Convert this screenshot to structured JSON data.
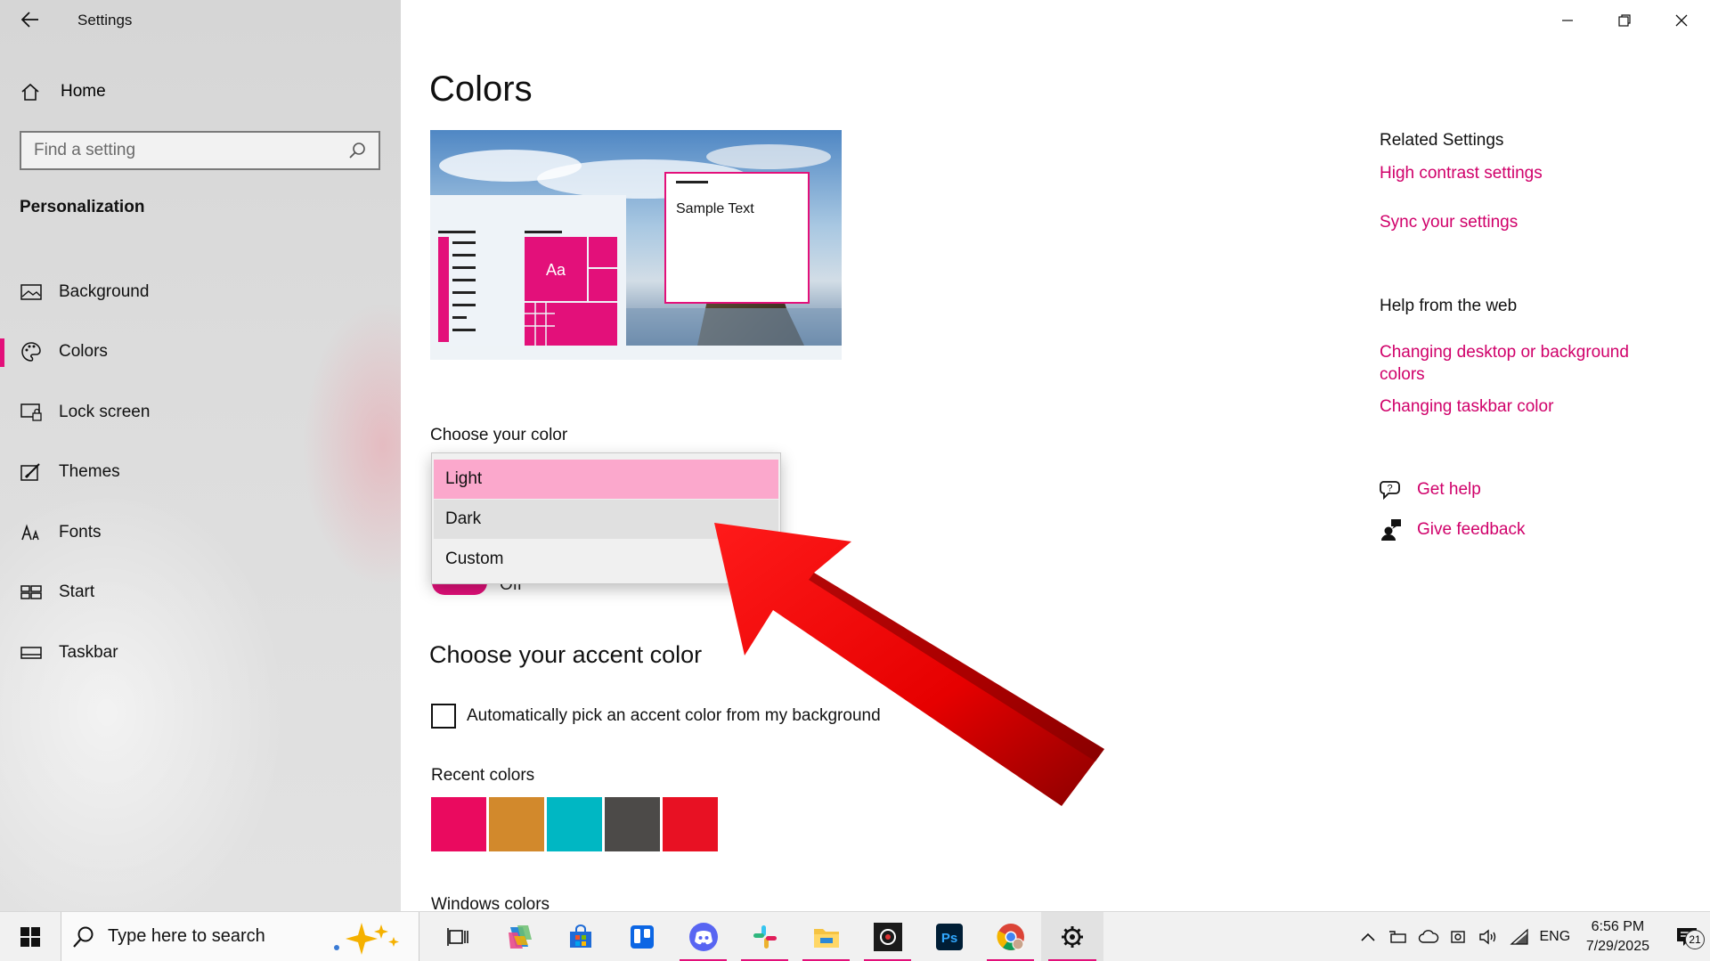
{
  "window": {
    "title": "Settings"
  },
  "sidebar": {
    "home_label": "Home",
    "search_placeholder": "Find a setting",
    "section": "Personalization",
    "items": [
      {
        "label": "Background",
        "icon": "image-icon"
      },
      {
        "label": "Colors",
        "icon": "palette-icon",
        "active": true
      },
      {
        "label": "Lock screen",
        "icon": "lock-screen-icon"
      },
      {
        "label": "Themes",
        "icon": "brush-icon"
      },
      {
        "label": "Fonts",
        "icon": "font-icon"
      },
      {
        "label": "Start",
        "icon": "start-icon"
      },
      {
        "label": "Taskbar",
        "icon": "taskbar-icon"
      }
    ]
  },
  "main": {
    "title": "Colors",
    "preview": {
      "sample_text": "Sample Text",
      "tile_text": "Aa"
    },
    "choose_color_label": "Choose your color",
    "dropdown_options": [
      "Light",
      "Dark",
      "Custom"
    ],
    "dropdown_selected": "Light",
    "toggle_state_text": "Off",
    "accent_heading": "Choose your accent color",
    "auto_pick_label": "Automatically pick an accent color from my background",
    "auto_pick_checked": false,
    "recent_colors_label": "Recent colors",
    "recent_colors": [
      "#ea0a5f",
      "#d2892c",
      "#00b7c3",
      "#4c4a48",
      "#e81123"
    ],
    "windows_colors_label": "Windows colors"
  },
  "related": {
    "heading": "Related Settings",
    "links": [
      "High contrast settings",
      "Sync your settings"
    ],
    "help_heading": "Help from the web",
    "help_links": [
      "Changing desktop or background colors",
      "Changing taskbar color"
    ],
    "get_help": "Get help",
    "give_feedback": "Give feedback"
  },
  "taskbar": {
    "search_text": "Type here to search",
    "apps": [
      "task-view-icon",
      "copilot-icon",
      "store-icon",
      "trello-icon",
      "discord-icon",
      "slack-icon",
      "file-explorer-icon",
      "obs-icon",
      "photoshop-icon",
      "chrome-icon",
      "settings-gear-icon"
    ],
    "language": "ENG",
    "time": "6:56 PM",
    "date": "7/29/2025",
    "notification_count": "21"
  },
  "colors": {
    "accent": "#e3107a",
    "link": "#d0006a",
    "selected_option": "#fba8cc"
  }
}
